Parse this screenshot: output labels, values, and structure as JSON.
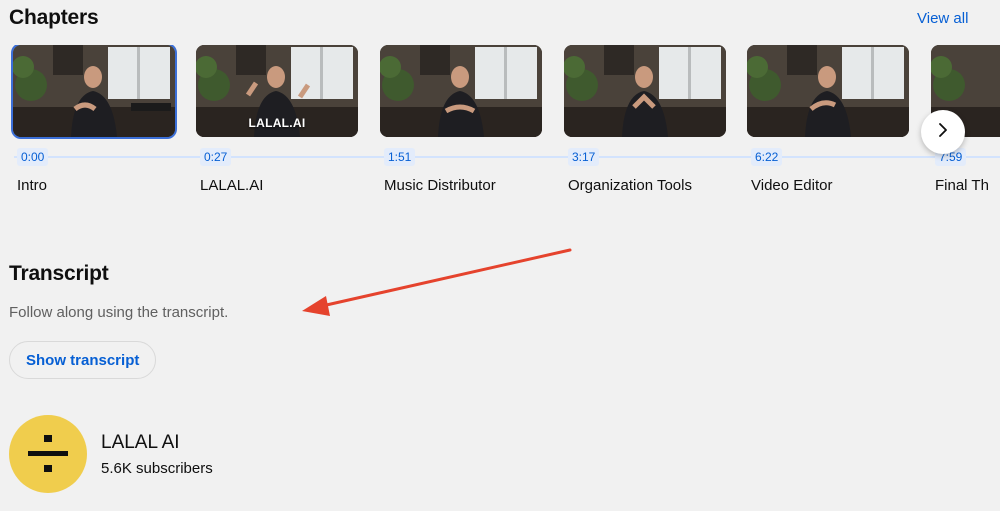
{
  "chapters": {
    "title": "Chapters",
    "view_all_label": "View all",
    "items": [
      {
        "time": "0:00",
        "title": "Intro",
        "thumb_text": ""
      },
      {
        "time": "0:27",
        "title": "LALAL.AI",
        "thumb_text": "LALAL.AI"
      },
      {
        "time": "1:51",
        "title": "Music Distributor",
        "thumb_text": ""
      },
      {
        "time": "3:17",
        "title": "Organization Tools",
        "thumb_text": ""
      },
      {
        "time": "6:22",
        "title": "Video Editor",
        "thumb_text": ""
      },
      {
        "time": "7:59",
        "title": "Final Th",
        "thumb_text": ""
      }
    ],
    "next_icon": "chevron-right-icon"
  },
  "transcript": {
    "title": "Transcript",
    "description": "Follow along using the transcript.",
    "button_label": "Show transcript"
  },
  "channel": {
    "name": "LALAL AI",
    "subscribers": "5.6K subscribers",
    "avatar_icon": "divide-icon",
    "avatar_color": "#f0cd4d"
  },
  "colors": {
    "accent": "#065fd4",
    "annotation_arrow": "#e5432d"
  }
}
